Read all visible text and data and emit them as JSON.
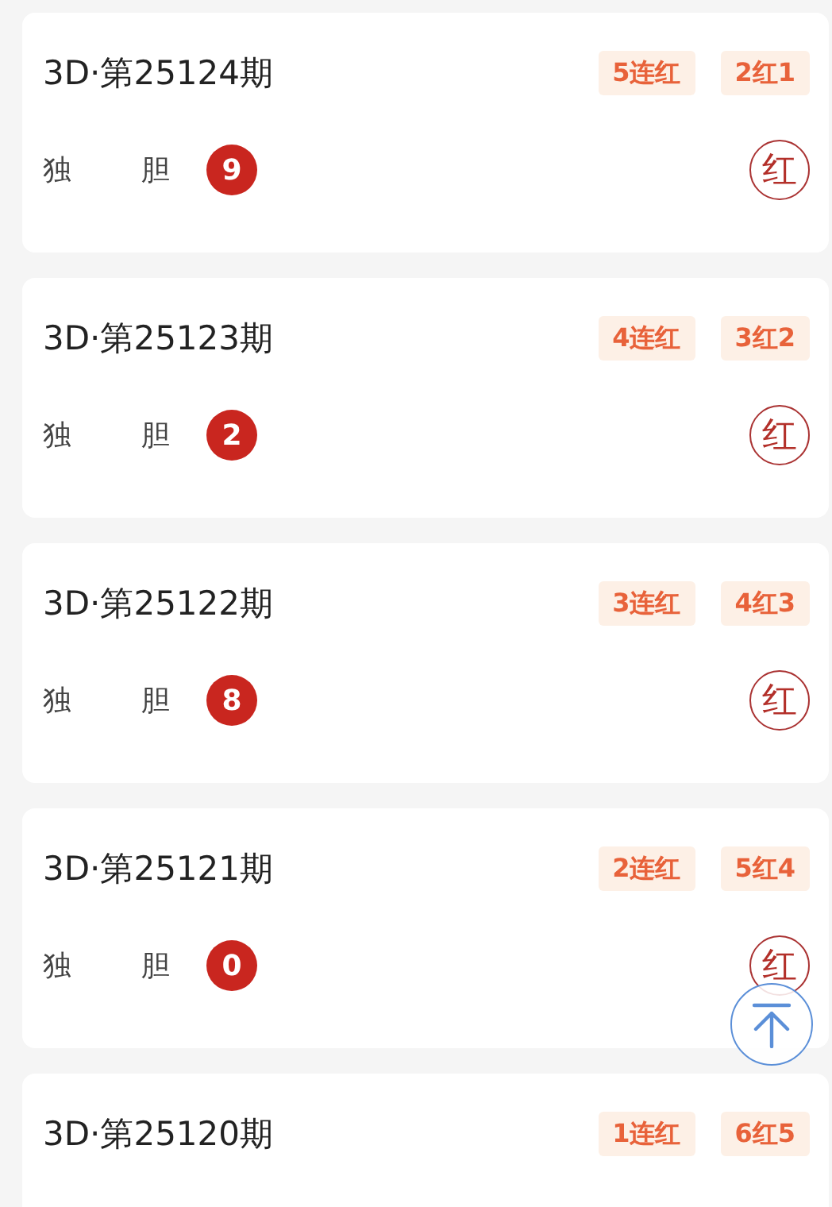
{
  "records": [
    {
      "title": "3D·第25124期",
      "tags": [
        "5连红",
        "2红1"
      ],
      "label": "独 胆",
      "number": "9",
      "result": "红"
    },
    {
      "title": "3D·第25123期",
      "tags": [
        "4连红",
        "3红2"
      ],
      "label": "独 胆",
      "number": "2",
      "result": "红"
    },
    {
      "title": "3D·第25122期",
      "tags": [
        "3连红",
        "4红3"
      ],
      "label": "独 胆",
      "number": "8",
      "result": "红"
    },
    {
      "title": "3D·第25121期",
      "tags": [
        "2连红",
        "5红4"
      ],
      "label": "独 胆",
      "number": "0",
      "result": "红"
    },
    {
      "title": "3D·第25120期",
      "tags": [
        "1连红",
        "6红5"
      ]
    }
  ],
  "back_to_top": {
    "kind": "button"
  }
}
